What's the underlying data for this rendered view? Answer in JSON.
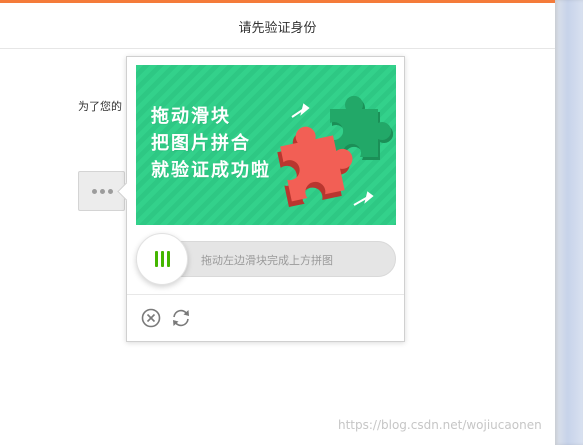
{
  "header": {
    "title": "请先验证身份"
  },
  "notice": {
    "text": "为了您的"
  },
  "captcha": {
    "image_text_lines": [
      "拖动滑块",
      "把图片拼合",
      "就验证成功啦"
    ],
    "slider_hint": "拖动左边滑块完成上方拼图",
    "icons": [
      "close-icon",
      "refresh-icon"
    ]
  },
  "colors": {
    "accent": "#f47b3a",
    "captcha_bg": "#33d18b",
    "puzzle_red": "#f25f55",
    "puzzle_green": "#22a868",
    "handle_bars": "#44b600"
  },
  "watermark": {
    "text": "https://blog.csdn.net/wojiucaonen"
  }
}
